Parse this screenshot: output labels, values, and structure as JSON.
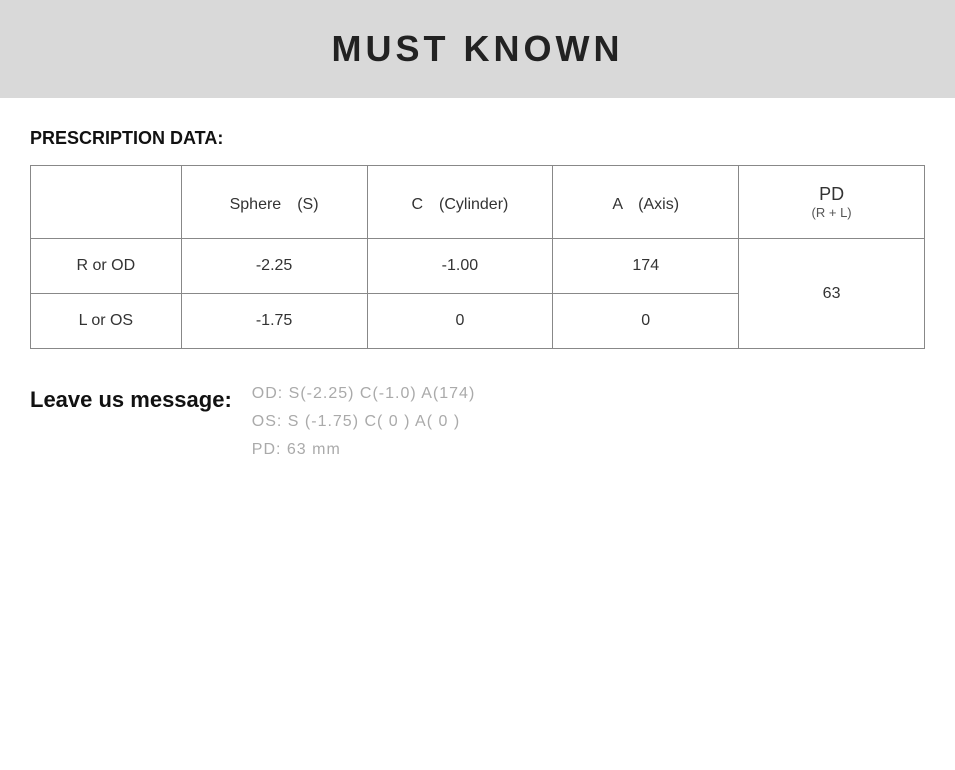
{
  "header": {
    "title": "MUST KNOWN"
  },
  "prescription_section": {
    "label": "PRESCRIPTION DATA:",
    "table": {
      "headers": {
        "row_label": "",
        "sphere": "Sphere　(S)",
        "cylinder": "C　(Cylinder)",
        "axis": "A　(Axis)",
        "pd_main": "PD",
        "pd_sub": "(R + L)"
      },
      "rows": [
        {
          "label": "R or OD",
          "sphere": "-2.25",
          "cylinder": "-1.00",
          "axis": "174",
          "pd": "63"
        },
        {
          "label": "L or OS",
          "sphere": "-1.75",
          "cylinder": "0",
          "axis": "0",
          "pd": ""
        }
      ]
    }
  },
  "leave_message": {
    "label": "Leave us message:",
    "lines": [
      "OD:  S(-2.25)    C(-1.0)    A(174)",
      "OS:  S (-1.75)    C( 0 )     A( 0 )",
      "PD:  63 mm"
    ]
  }
}
